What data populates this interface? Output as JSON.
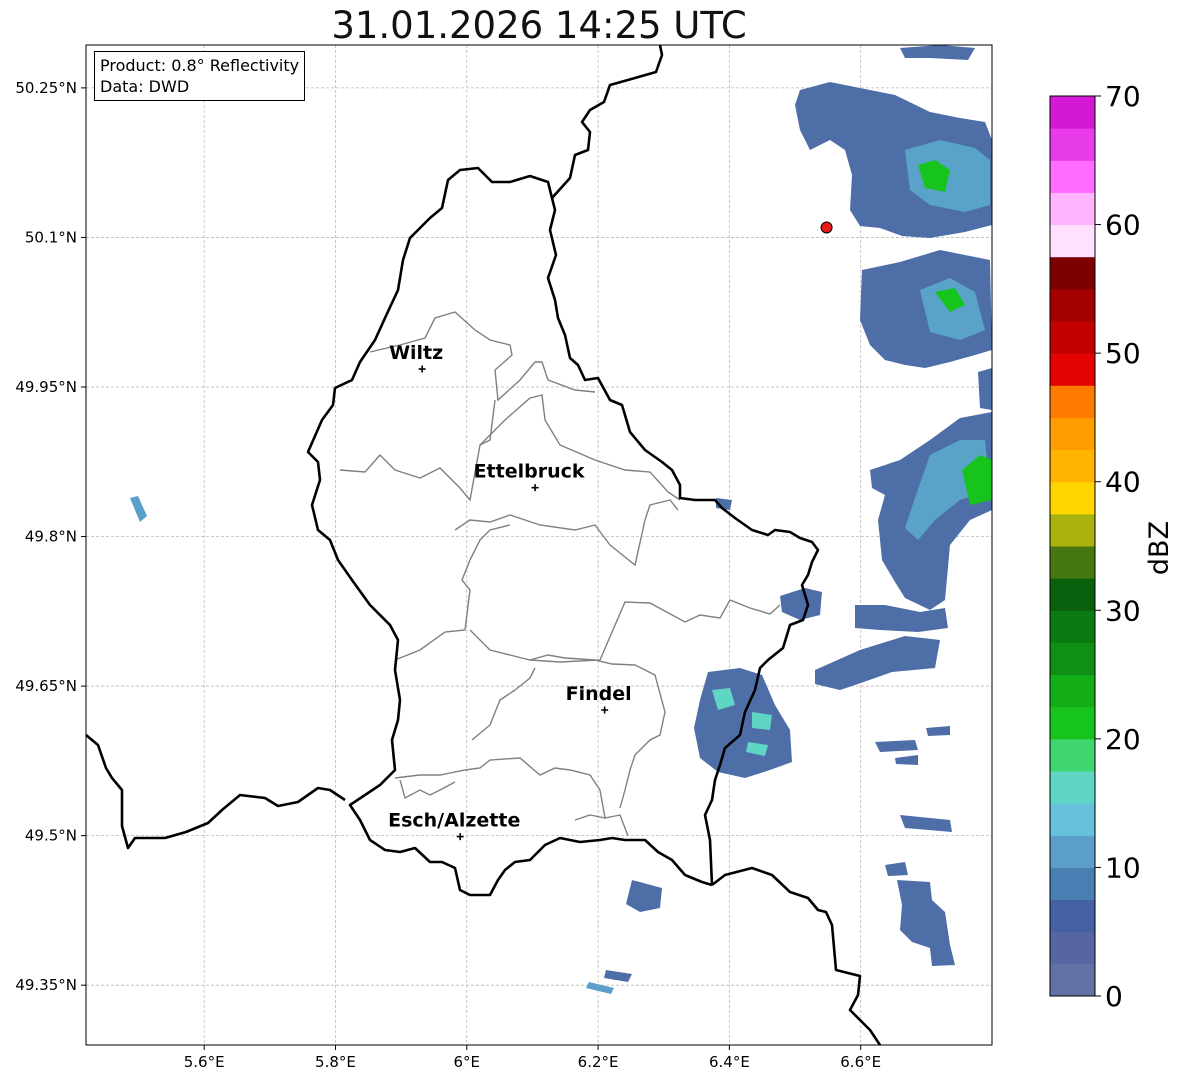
{
  "title": "31.01.2026 14:25 UTC",
  "info_box": {
    "product": "Product: 0.8° Reflectivity",
    "data": "Data: DWD"
  },
  "map": {
    "lon_range": [
      5.42,
      6.8
    ],
    "lat_range": [
      49.29,
      50.293
    ],
    "x_ticks": [
      "5.6°E",
      "5.8°E",
      "6°E",
      "6.2°E",
      "6.4°E",
      "6.6°E"
    ],
    "x_tick_values": [
      5.6,
      5.8,
      6.0,
      6.2,
      6.4,
      6.6
    ],
    "y_ticks": [
      "50.25°N",
      "50.1°N",
      "49.95°N",
      "49.8°N",
      "49.65°N",
      "49.5°N",
      "49.35°N"
    ],
    "y_tick_values": [
      50.25,
      50.1,
      49.95,
      49.8,
      49.65,
      49.5,
      49.35
    ],
    "grid": true,
    "radar_site_marker": {
      "lon": 6.548,
      "lat": 50.11,
      "color": "#e8181b"
    },
    "cities": [
      {
        "name": "Wiltz",
        "lon": 5.932,
        "lat": 49.968
      },
      {
        "name": "Ettelbruck",
        "lon": 6.104,
        "lat": 49.849
      },
      {
        "name": "Findel",
        "lon": 6.21,
        "lat": 49.626
      },
      {
        "name": "Esch/Alzette",
        "lon": 5.99,
        "lat": 49.499
      }
    ]
  },
  "colorbar": {
    "label": "dBZ",
    "min": 0,
    "max": 70,
    "step": 2.5,
    "ticks": [
      "0",
      "10",
      "20",
      "30",
      "40",
      "50",
      "60",
      "70"
    ],
    "colors": [
      "#6471a5",
      "#5566a0",
      "#4361a3",
      "#4a7fb3",
      "#5b9fca",
      "#66c1dc",
      "#5fd5c3",
      "#3fd56f",
      "#16c41d",
      "#13ae18",
      "#0f8f13",
      "#0b7a10",
      "#085f0c",
      "#477711",
      "#aab30d",
      "#ffd500",
      "#ffb400",
      "#ff9d00",
      "#ff7b00",
      "#e40303",
      "#c30000",
      "#a30000",
      "#7c0000",
      "#ffe0ff",
      "#ffb4ff",
      "#ff6cff",
      "#e83bea",
      "#d419d4"
    ]
  }
}
